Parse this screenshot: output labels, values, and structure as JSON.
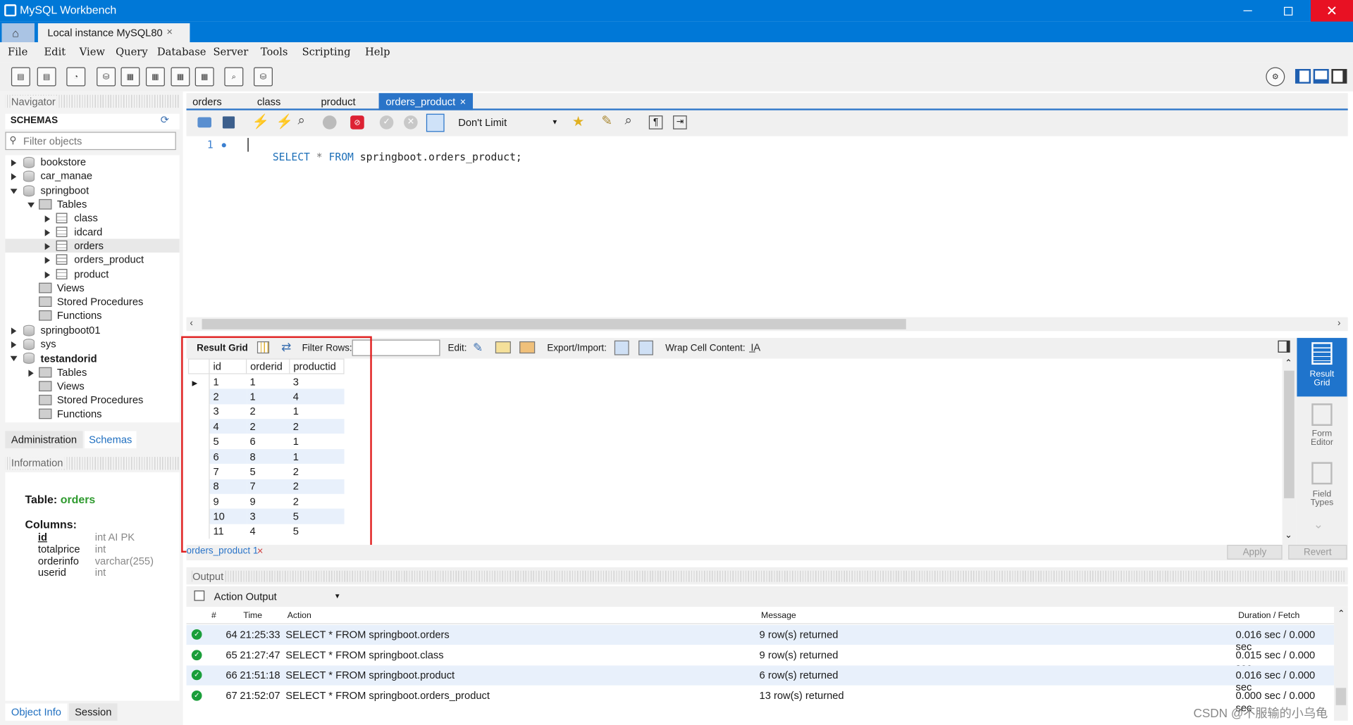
{
  "window": {
    "title": "MySQL Workbench",
    "connection_tab": "Local instance MySQL80"
  },
  "menu": [
    "File",
    "Edit",
    "View",
    "Query",
    "Database",
    "Server",
    "Tools",
    "Scripting",
    "Help"
  ],
  "navigator": {
    "title": "Navigator",
    "schemas_header": "SCHEMAS",
    "filter_placeholder": "Filter objects",
    "tree": {
      "bookstore": "bookstore",
      "car_manae": "car_manae",
      "springboot": "springboot",
      "tables": "Tables",
      "class": "class",
      "idcard": "idcard",
      "orders": "orders",
      "orders_product": "orders_product",
      "product": "product",
      "views": "Views",
      "stored_procedures": "Stored Procedures",
      "functions": "Functions",
      "springboot01": "springboot01",
      "sys": "sys",
      "testandorid": "testandorid"
    },
    "tabs": {
      "administration": "Administration",
      "schemas": "Schemas"
    }
  },
  "information": {
    "header": "Information",
    "table_label": "Table:",
    "table_name": "orders",
    "columns_label": "Columns:",
    "columns": [
      {
        "name": "id",
        "type": "int AI PK"
      },
      {
        "name": "totalprice",
        "type": "int"
      },
      {
        "name": "orderinfo",
        "type": "varchar(255)"
      },
      {
        "name": "userid",
        "type": "int"
      }
    ],
    "tabs": {
      "object_info": "Object Info",
      "session": "Session"
    }
  },
  "editor": {
    "tabs": [
      "orders",
      "class",
      "product",
      "orders_product"
    ],
    "active_tab": "orders_product",
    "limit": "Don't Limit",
    "line_number": "1",
    "sql": {
      "k1": "SELECT",
      "star": "*",
      "k2": "FROM",
      "rest": "springboot.orders_product;"
    }
  },
  "result": {
    "grid_label": "Result Grid",
    "filter_label": "Filter Rows:",
    "edit_label": "Edit:",
    "export_label": "Export/Import:",
    "wrap_label": "Wrap Cell Content:",
    "headers": [
      "id",
      "orderid",
      "productid"
    ],
    "rows": [
      [
        "1",
        "1",
        "3"
      ],
      [
        "2",
        "1",
        "4"
      ],
      [
        "3",
        "2",
        "1"
      ],
      [
        "4",
        "2",
        "2"
      ],
      [
        "5",
        "6",
        "1"
      ],
      [
        "6",
        "8",
        "1"
      ],
      [
        "7",
        "5",
        "2"
      ],
      [
        "8",
        "7",
        "2"
      ],
      [
        "9",
        "9",
        "2"
      ],
      [
        "10",
        "3",
        "5"
      ],
      [
        "11",
        "4",
        "5"
      ]
    ],
    "result_tab": "orders_product 1",
    "apply": "Apply",
    "revert": "Revert",
    "side": {
      "result_grid": "Result Grid",
      "form_editor": "Form Editor",
      "field_types": "Field Types"
    }
  },
  "output": {
    "header": "Output",
    "mode": "Action Output",
    "columns": {
      "num": "#",
      "time": "Time",
      "action": "Action",
      "message": "Message",
      "duration": "Duration / Fetch"
    },
    "rows": [
      {
        "num": "64",
        "time": "21:25:33",
        "action": "SELECT * FROM springboot.orders",
        "message": "9 row(s) returned",
        "duration": "0.016 sec / 0.000 sec"
      },
      {
        "num": "65",
        "time": "21:27:47",
        "action": "SELECT * FROM springboot.class",
        "message": "9 row(s) returned",
        "duration": "0.015 sec / 0.000 sec"
      },
      {
        "num": "66",
        "time": "21:51:18",
        "action": "SELECT * FROM springboot.product",
        "message": "6 row(s) returned",
        "duration": "0.016 sec / 0.000 sec"
      },
      {
        "num": "67",
        "time": "21:52:07",
        "action": "SELECT * FROM springboot.orders_product",
        "message": "13 row(s) returned",
        "duration": "0.000 sec / 0.000 sec"
      }
    ]
  },
  "watermark": "CSDN @不服输的小乌龟",
  "colors": {
    "accent": "#0078d7",
    "highlight": "#e02020",
    "keyword": "#1d6fb8"
  }
}
